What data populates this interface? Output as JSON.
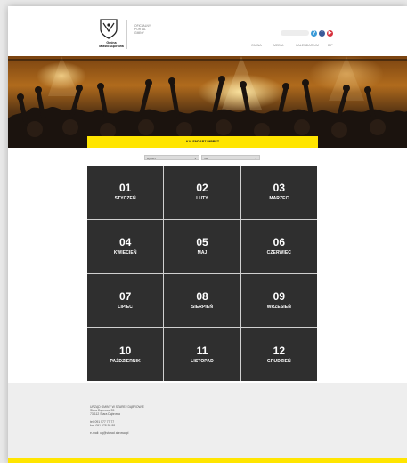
{
  "header": {
    "logo_lines": [
      "Gmina",
      "Miasto Dąbrowa"
    ],
    "portal_lines": [
      "Oficjalny",
      "portal",
      "gminy"
    ],
    "search": {
      "placeholder": ""
    },
    "social": [
      {
        "icon": "search-icon",
        "glyph": "⚲",
        "color": "#3b9bd8"
      },
      {
        "icon": "facebook-icon",
        "glyph": "f",
        "color": "#3b5a99"
      },
      {
        "icon": "youtube-icon",
        "glyph": "▶",
        "color": "#d6303c"
      }
    ],
    "nav": [
      "Gmina",
      "Media",
      "Kalendarium",
      "BIP"
    ]
  },
  "hero": {
    "alt": ""
  },
  "calendar": {
    "title": "Kalendarz imprez",
    "filters": [
      {
        "value": "wybierz",
        "arrow": "▼"
      },
      {
        "value": "rok",
        "arrow": "▼"
      }
    ],
    "months": [
      {
        "num": "01",
        "name": "STYCZEŃ"
      },
      {
        "num": "02",
        "name": "LUTY"
      },
      {
        "num": "03",
        "name": "MARZEC"
      },
      {
        "num": "04",
        "name": "KWIECIEŃ"
      },
      {
        "num": "05",
        "name": "MAJ"
      },
      {
        "num": "06",
        "name": "CZERWIEC"
      },
      {
        "num": "07",
        "name": "LIPIEC"
      },
      {
        "num": "08",
        "name": "SIERPIEŃ"
      },
      {
        "num": "09",
        "name": "WRZESIEŃ"
      },
      {
        "num": "10",
        "name": "PAŹDZIERNIK"
      },
      {
        "num": "11",
        "name": "LISTOPAD"
      },
      {
        "num": "12",
        "name": "GRUDZIEŃ"
      }
    ]
  },
  "footer": {
    "address": [
      "URZĄD GMINY W STAREJ DĄBROWIE",
      "Stara Dąbrowa 35",
      "73-112 Stara Dąbrowa"
    ],
    "phones": [
      "tel. 091 577 77 77",
      "fax. 091 578 55 88"
    ],
    "email": "e-mail: ug@starad abrowa.pl"
  },
  "colors": {
    "accent": "#ffe500",
    "tile": "#2f2f2f",
    "footer": "#eeeeee"
  }
}
